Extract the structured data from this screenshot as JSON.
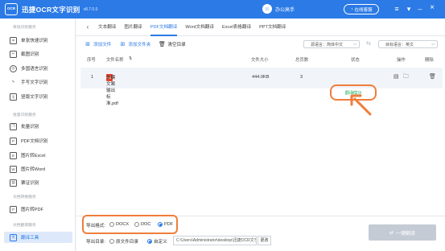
{
  "app": {
    "logo_text": "OCR",
    "name": "迅捷OCR文字识别",
    "version": "v8.7.0.0",
    "user": "办公高手",
    "kefu": "在线客服"
  },
  "sidebar": {
    "groups": [
      "单张识别服务",
      "批量识别服务",
      "文档转换服务",
      "文档翻译服务"
    ],
    "items": [
      {
        "label": "单张快速识别",
        "icon": "image-scan-icon"
      },
      {
        "label": "截图识别",
        "icon": "screenshot-icon"
      },
      {
        "label": "多国语言识别",
        "icon": "globe-icon"
      },
      {
        "label": "手写文字识别",
        "icon": "pen-icon"
      },
      {
        "label": "竖版文字识别",
        "icon": "vertical-text-icon"
      },
      {
        "label": "批量识别",
        "icon": "batch-icon"
      },
      {
        "label": "PDF文档识别",
        "icon": "pdf-icon"
      },
      {
        "label": "图片转Excel",
        "icon": "excel-icon"
      },
      {
        "label": "图片转Word",
        "icon": "word-icon"
      },
      {
        "label": "票证识别",
        "icon": "ticket-icon"
      },
      {
        "label": "图片转PDF",
        "icon": "image-pdf-icon"
      },
      {
        "label": "翻译工具",
        "icon": "translate-icon"
      }
    ]
  },
  "tabs": [
    "文本翻译",
    "图片翻译",
    "PDF文档翻译",
    "Word文档翻译",
    "Excel表格翻译",
    "PPT文档翻译"
  ],
  "active_tab": 2,
  "toolbar": {
    "add_file": "添加文件",
    "add_folder": "添加文件夹",
    "clear": "清空目录"
  },
  "source_lang": "源语言：简体中文",
  "target_lang": "目标语言：英文",
  "columns": {
    "index": "序号",
    "name": "文件名称",
    "size": "文件大小",
    "pages": "总页数",
    "status": "状态",
    "ops": "操作",
    "delete": "删除"
  },
  "rows": [
    {
      "index": "1",
      "name": "外模文案输出标准.pdf",
      "size": "444.0KB",
      "pages": "3",
      "status": "翻译成功"
    }
  ],
  "bottom": {
    "format_label": "导出格式:",
    "formats": [
      "DOCX",
      "DOC",
      "PDF"
    ],
    "selected_format": "PDF",
    "dir_label": "导出目录:",
    "dir_opts": [
      "原文件目录",
      "自定义"
    ],
    "dir_selected": "自定义",
    "path": "C:\\Users\\Administrator\\desktop\\迅捷OCR文字",
    "change": "更改",
    "go": "一键翻译"
  },
  "colors": {
    "primary": "#2b7ae6",
    "highlight": "#f07d3a",
    "success": "#27ae60"
  }
}
